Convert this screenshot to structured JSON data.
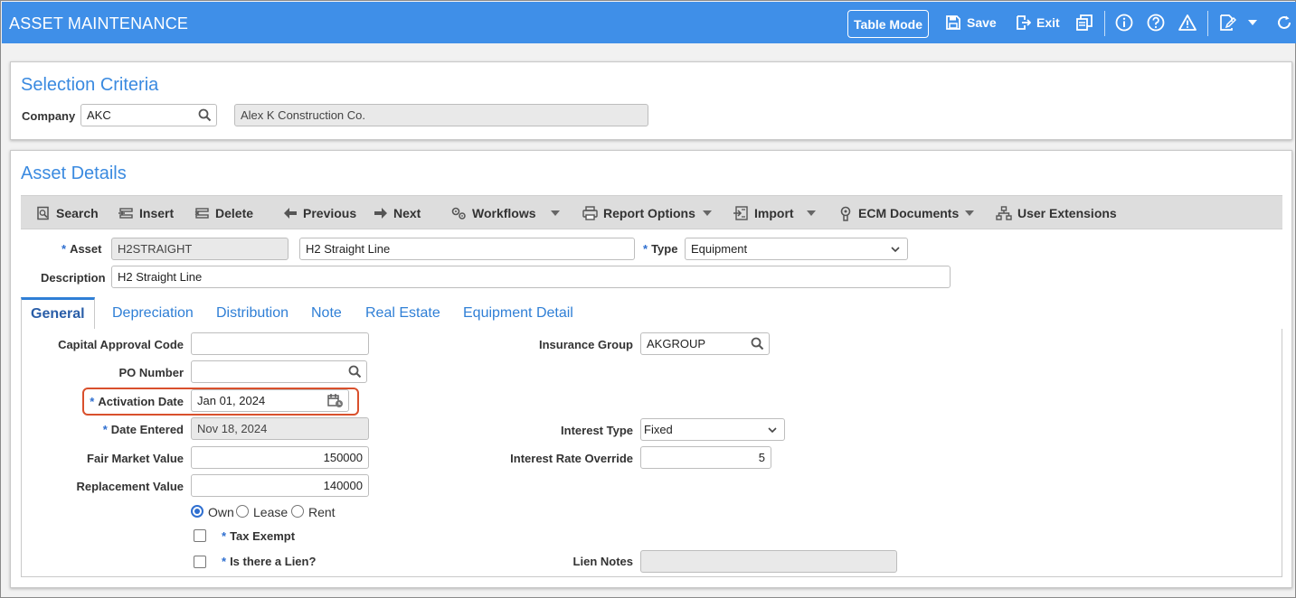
{
  "app": {
    "title": "ASSET MAINTENANCE",
    "table_mode_label": "Table Mode",
    "save_label": "Save",
    "exit_label": "Exit"
  },
  "selection": {
    "title": "Selection Criteria",
    "company_label": "Company",
    "company_value": "AKC",
    "company_name": "Alex K Construction Co."
  },
  "details": {
    "title": "Asset Details",
    "toolbar": {
      "search": "Search",
      "insert": "Insert",
      "delete": "Delete",
      "previous": "Previous",
      "next": "Next",
      "workflows": "Workflows",
      "report_options": "Report Options",
      "import": "Import",
      "ecm_documents": "ECM Documents",
      "user_extensions": "User Extensions"
    },
    "asset_label": "Asset",
    "asset_code": "H2STRAIGHT",
    "asset_name": "H2 Straight Line",
    "type_label": "Type",
    "type_value": "Equipment",
    "description_label": "Description",
    "description_value": "H2 Straight Line"
  },
  "tabs": [
    "General",
    "Depreciation",
    "Distribution",
    "Note",
    "Real Estate",
    "Equipment Detail"
  ],
  "general": {
    "capital_approval_label": "Capital Approval Code",
    "capital_approval_value": "",
    "po_number_label": "PO Number",
    "po_number_value": "",
    "activation_date_label": "Activation Date",
    "activation_date_value": "Jan 01, 2024",
    "date_entered_label": "Date Entered",
    "date_entered_value": "Nov 18, 2024",
    "fair_market_label": "Fair Market Value",
    "fair_market_value": "150000",
    "replacement_label": "Replacement Value",
    "replacement_value": "140000",
    "ownership_options": [
      "Own",
      "Lease",
      "Rent"
    ],
    "ownership_selected": "Own",
    "tax_exempt_label": "Tax Exempt",
    "lien_label": "Is there a Lien?",
    "insurance_group_label": "Insurance Group",
    "insurance_group_value": "AKGROUP",
    "interest_type_label": "Interest Type",
    "interest_type_value": "Fixed",
    "interest_rate_label": "Interest Rate Override",
    "interest_rate_value": "5",
    "lien_notes_label": "Lien Notes",
    "lien_notes_value": ""
  },
  "colors": {
    "header": "#3f8fe8",
    "accent": "#2f7fd6",
    "highlight": "#d9502c"
  }
}
